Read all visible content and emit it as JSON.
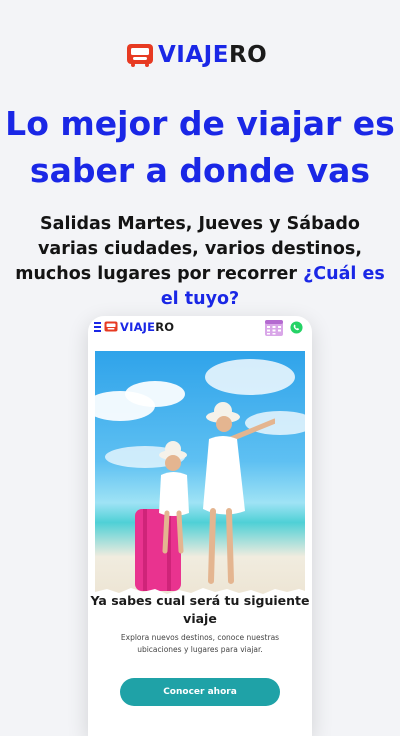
{
  "brand": {
    "part1": "VIAJE",
    "part2": "RO"
  },
  "headline": "Lo mejor de viajar es saber a donde vas",
  "subheadline": {
    "text": "Salidas Martes, Jueves y Sábado varias ciudades, varios destinos, muchos lugares por recorrer ",
    "question": "¿Cuál es el tuyo?"
  },
  "phone": {
    "brand": {
      "part1": "VIAJE",
      "part2": "RO"
    },
    "card_title": "Ya sabes cual será tu siguiente viaje",
    "card_text": "Explora nuevos destinos, conoce nuestras ubicaciones y lugares para viajar.",
    "cta_label": "Conocer ahora"
  },
  "colors": {
    "brand_red": "#e73a22",
    "brand_blue": "#1a27e6",
    "cta": "#1fa2a7",
    "background": "#f3f4f7"
  },
  "icons": [
    "bus-logo-icon",
    "menu-icon",
    "calendar-icon",
    "whatsapp-icon"
  ]
}
